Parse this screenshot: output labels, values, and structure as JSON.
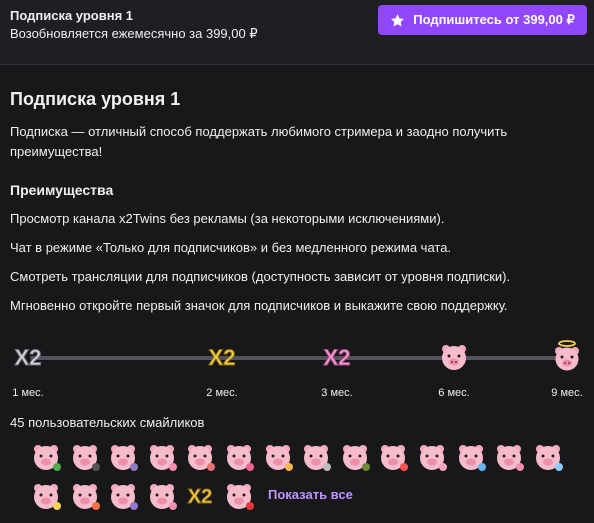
{
  "header": {
    "title": "Подписка уровня 1",
    "renew_text": "Возобновляется ежемесячно за 399,00 ₽",
    "subscribe_button": "Подпишитесь от 399,00 ₽"
  },
  "main": {
    "heading": "Подписка уровня 1",
    "description": "Подписка — отличный способ поддержать любимого стримера и заодно получить преимущества!",
    "benefits_heading": "Преимущества",
    "benefits": [
      "Просмотр канала x2Twins без рекламы (за некоторыми исключениями).",
      "Чат в режиме «Только для подписчиков» и без медленного режима чата.",
      "Смотреть трансляции для подписчиков (доступность зависит от уровня подписки).",
      "Мгновенно откройте первый значок для подписчиков и выкажите свою поддержку."
    ],
    "badge_tiers": [
      {
        "label": "1 мес.",
        "icon": "x2-silver-badge-icon",
        "color": "#c9c9cf"
      },
      {
        "label": "2 мес.",
        "icon": "x2-gold-badge-icon",
        "color": "#f3d04a"
      },
      {
        "label": "3 мес.",
        "icon": "x2-pink-badge-icon",
        "color": "#f28cc6"
      },
      {
        "label": "6 мес.",
        "icon": "pig-badge-icon",
        "color": "#f7b6c6"
      },
      {
        "label": "9 мес.",
        "icon": "pig-halo-badge-icon",
        "color": "#f7b6c6"
      }
    ],
    "emotes_heading": "45 пользовательских смайликов",
    "emotes": [
      "pig-dino-emote-icon",
      "pig-hammer-emote-icon",
      "pig-confused-emote-icon",
      "pig-sad-emote-icon",
      "pig-love-emote-icon",
      "pig-happy-emote-icon",
      "pig-wave-emote-icon",
      "pig-eyes-emote-icon",
      "pig-army-emote-icon",
      "pig-party-emote-icon",
      "pig-clap-emote-icon",
      "pig-gift-emote-icon",
      "pig-facepalm-emote-icon",
      "pig-cry-emote-icon",
      "pig-hi-emote-icon",
      "pig-fire-emote-icon",
      "pig-sleep-emote-icon",
      "pig-wink-emote-icon",
      "x2-gold-emote-icon",
      "pig-boxing-emote-icon"
    ],
    "show_all": "Показать все"
  },
  "colors": {
    "accent": "#9147ff",
    "link": "#bf94ff",
    "background": "#18181b",
    "header_background": "#1f1f23"
  }
}
